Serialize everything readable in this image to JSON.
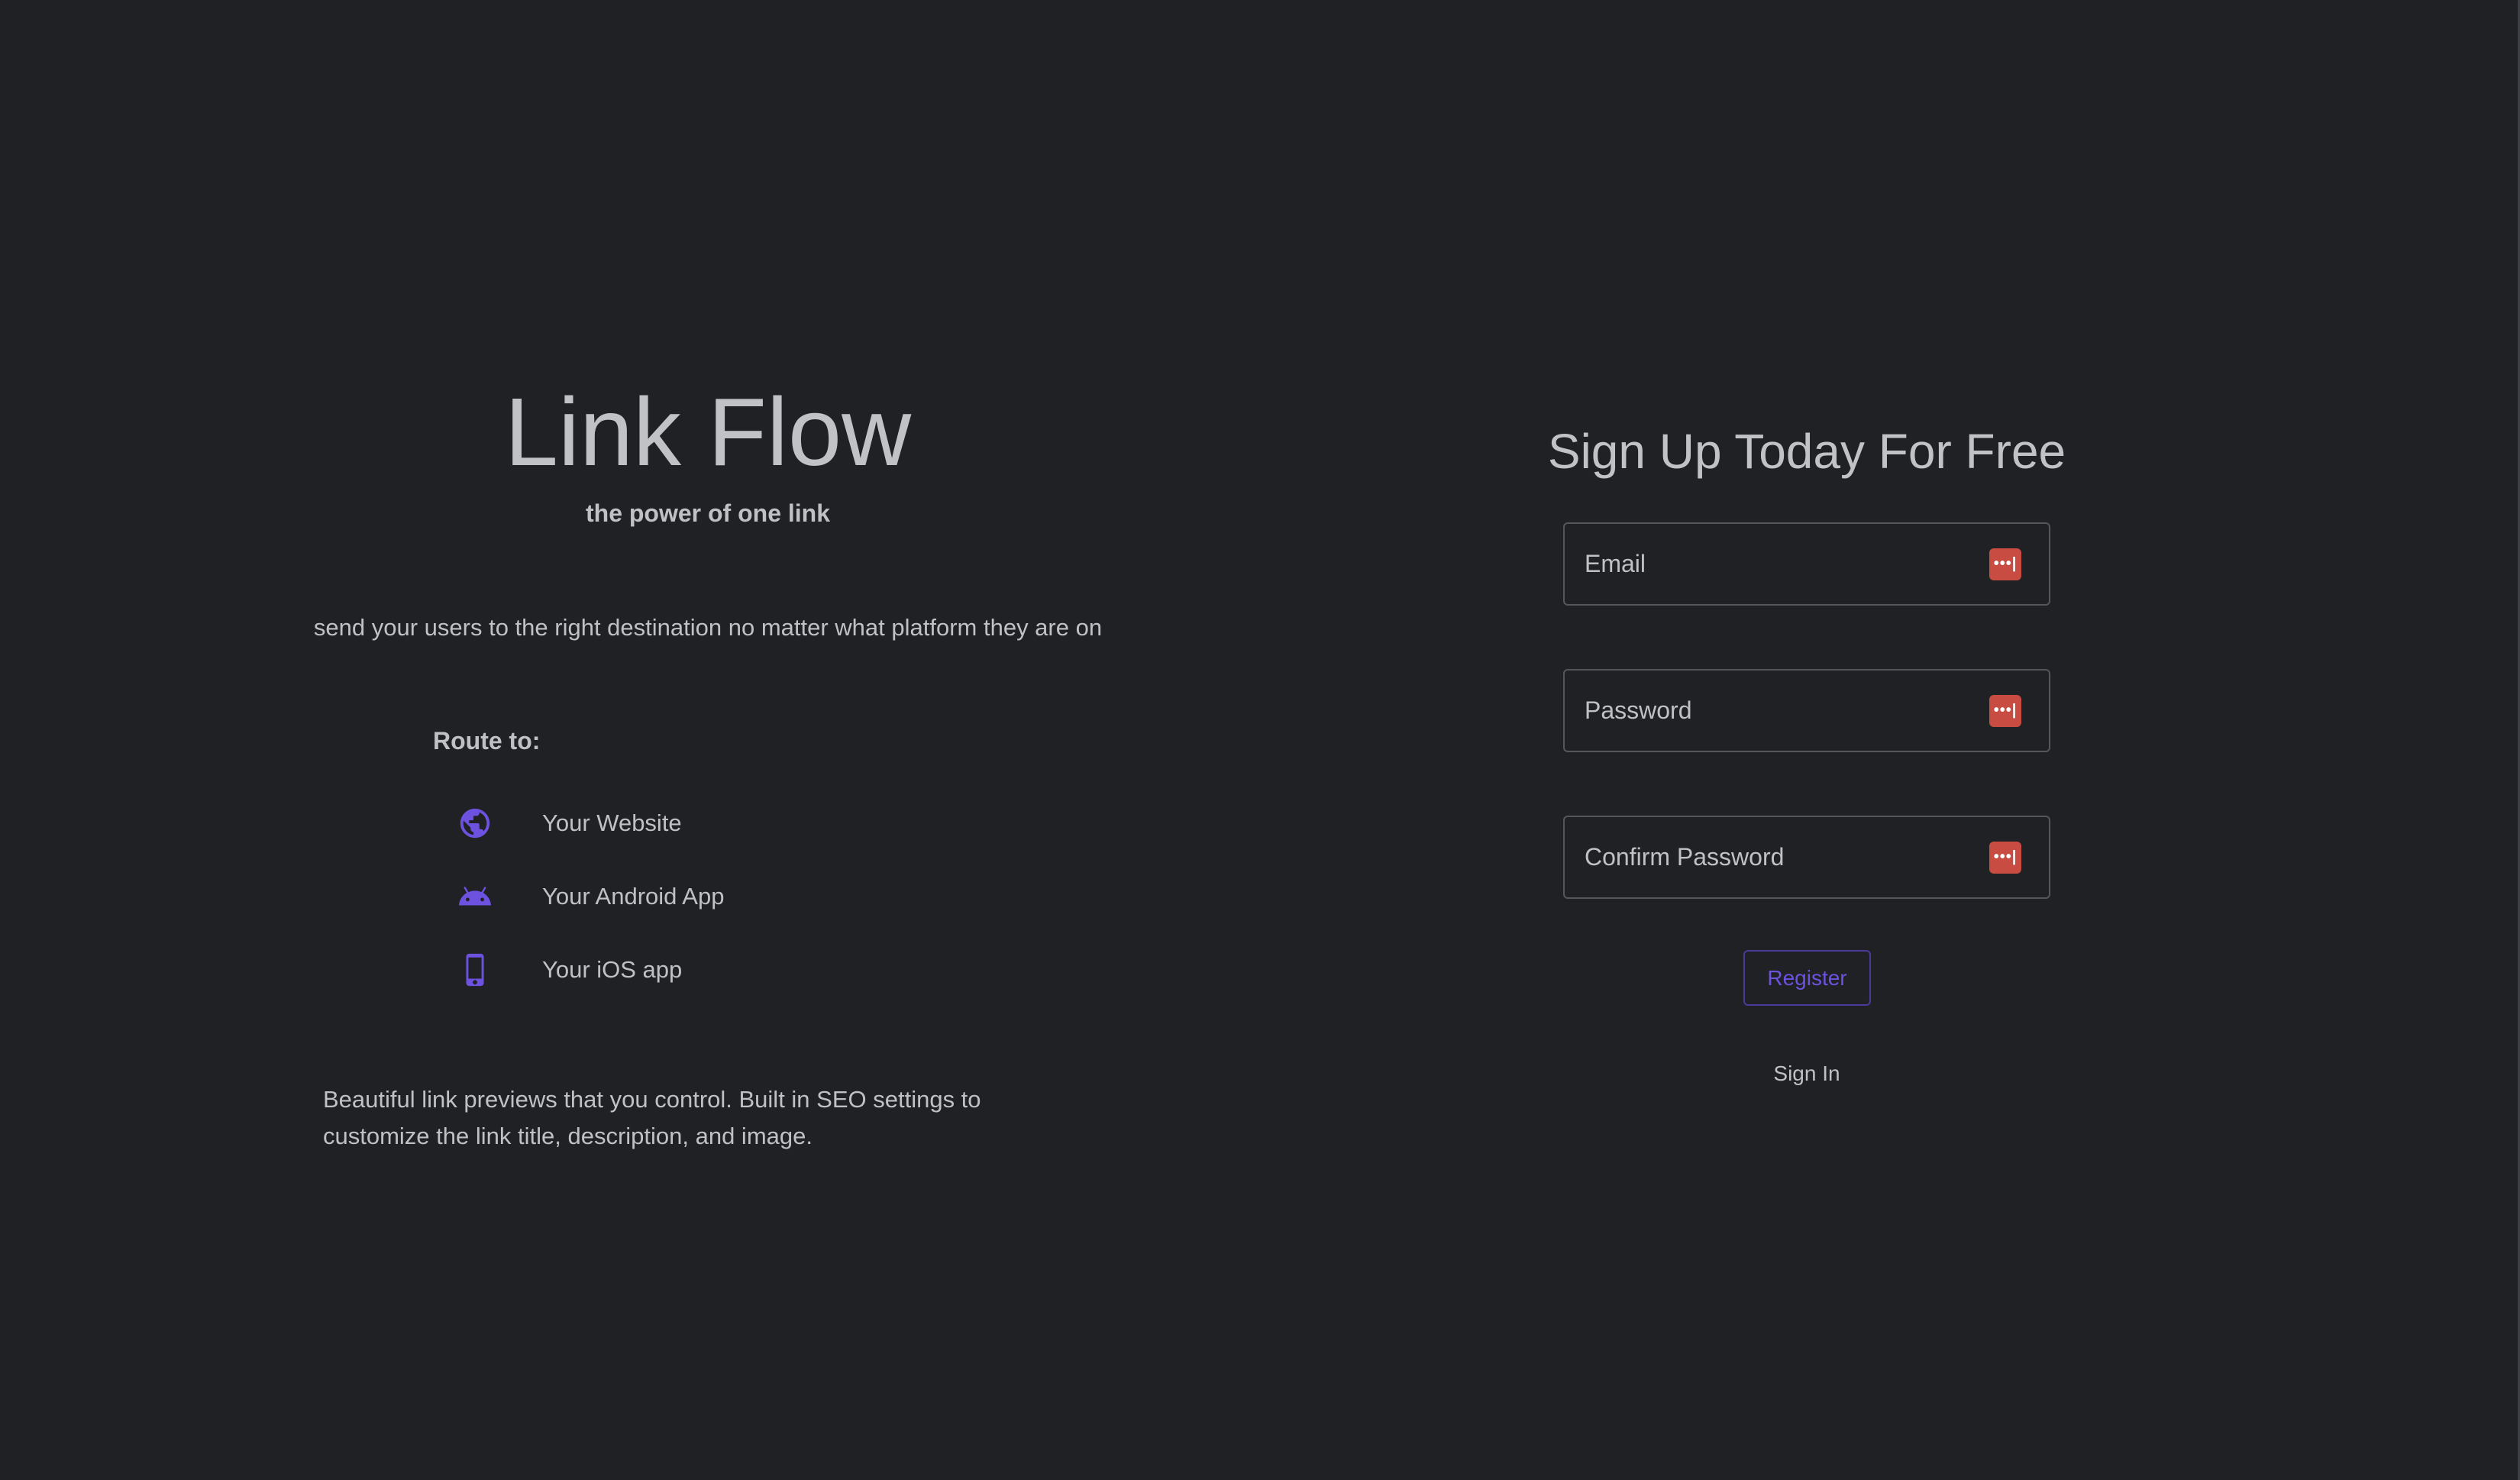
{
  "hero": {
    "title": "Link Flow",
    "tagline": "the power of one link",
    "description": "send your users to the right destination no matter what platform they are on",
    "route_heading": "Route to:",
    "routes": [
      {
        "icon": "globe-icon",
        "label": "Your Website"
      },
      {
        "icon": "android-icon",
        "label": "Your Android App"
      },
      {
        "icon": "smartphone-icon",
        "label": "Your iOS app"
      }
    ],
    "features": "Beautiful link previews that you control. Built in SEO settings to customize the link title, description, and image."
  },
  "signup": {
    "title": "Sign Up Today For Free",
    "fields": {
      "email": {
        "placeholder": "Email",
        "value": ""
      },
      "password": {
        "placeholder": "Password",
        "value": ""
      },
      "confirm_password": {
        "placeholder": "Confirm Password",
        "value": ""
      }
    },
    "password_manager_badge": "•••|",
    "register_label": "Register",
    "signin_label": "Sign In"
  },
  "colors": {
    "background": "#202125",
    "text": "#c0c1c5",
    "accent": "#6c52de",
    "password_manager": "#c94c43"
  }
}
